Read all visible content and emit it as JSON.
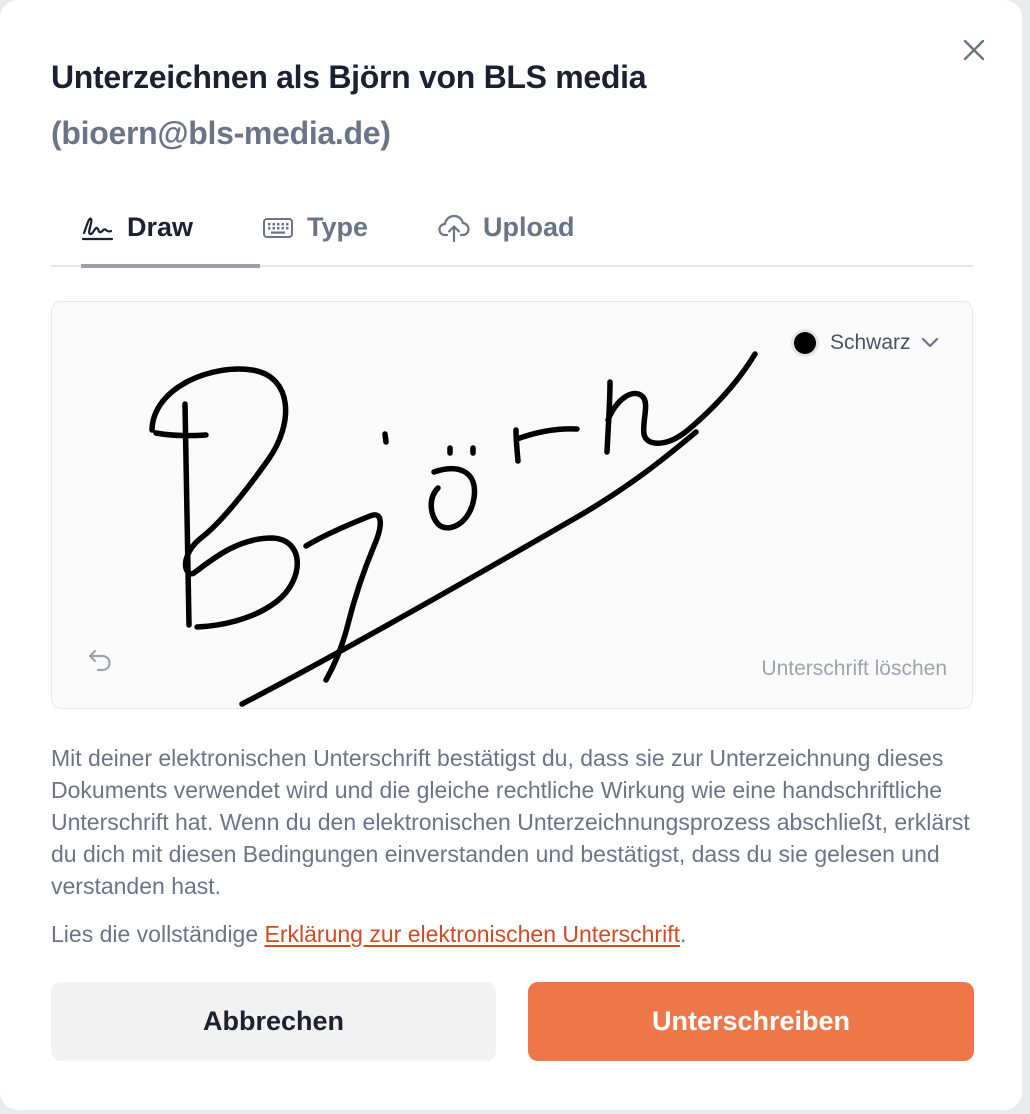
{
  "dialog": {
    "title": "Unterzeichnen als Björn von BLS media",
    "subtitle": "(bioern@bls-media.de)",
    "close_icon": "close-icon"
  },
  "tabs": [
    {
      "label": "Draw",
      "icon": "signature-icon",
      "active": true
    },
    {
      "label": "Type",
      "icon": "keyboard-icon",
      "active": false
    },
    {
      "label": "Upload",
      "icon": "cloud-upload-icon",
      "active": false
    }
  ],
  "canvas": {
    "pen_color_label": "Schwarz",
    "pen_color": "#000000",
    "clear_label": "Unterschrift löschen",
    "undo_icon": "undo-icon",
    "signature_text": "Björn"
  },
  "legal": {
    "text": "Mit deiner elektronischen Unterschrift bestätigst du, dass sie zur Unterzeichnung dieses Dokuments verwendet wird und die gleiche rechtliche Wirkung wie eine handschriftliche Unterschrift hat. Wenn du den elektronischen Unterzeichnungsprozess abschließt, erklärst du dich mit diesen Bedingungen einverstanden und bestätigst, dass du sie gelesen und verstanden hast.",
    "readmore_prefix": "Lies die vollständige ",
    "readmore_link": "Erklärung zur elektronischen Unterschrift",
    "readmore_suffix": "."
  },
  "buttons": {
    "cancel": "Abbrechen",
    "sign": "Unterschreiben"
  },
  "colors": {
    "accent": "#ee7749",
    "link": "#cf4b21",
    "text_primary": "#1b2130",
    "text_muted": "#6b7486"
  }
}
